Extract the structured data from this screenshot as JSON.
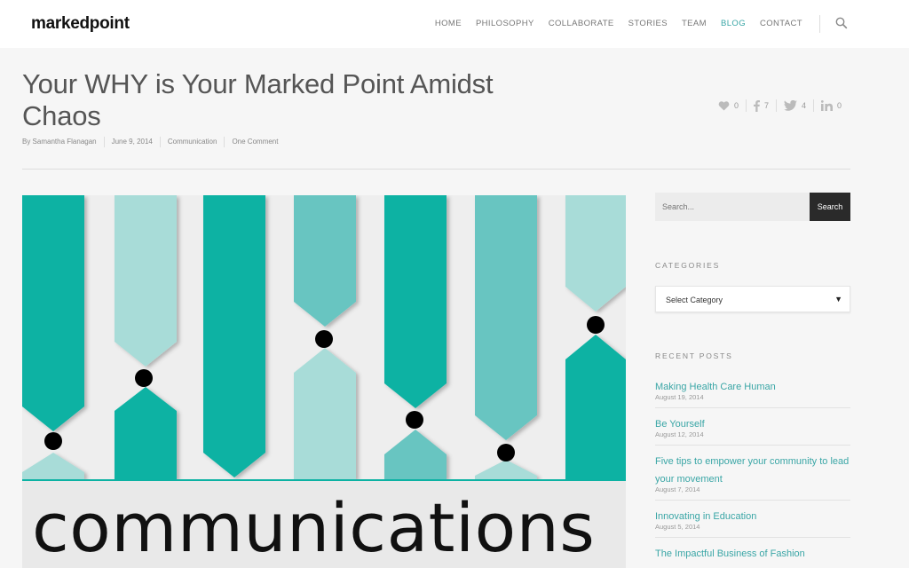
{
  "header": {
    "logo": "markedpoint",
    "nav": [
      {
        "label": "HOME"
      },
      {
        "label": "PHILOSOPHY"
      },
      {
        "label": "COLLABORATE"
      },
      {
        "label": "STORIES"
      },
      {
        "label": "TEAM"
      },
      {
        "label": "BLOG"
      },
      {
        "label": "CONTACT"
      }
    ],
    "active_nav": "BLOG",
    "accent_color": "#3aa6a6"
  },
  "post": {
    "title": "Your WHY is Your Marked Point Amidst Chaos",
    "author": "By Samantha Flanagan",
    "date": "June 9, 2014",
    "category": "Communication",
    "comments": "One Comment",
    "shares": {
      "likes": "0",
      "facebook": "7",
      "twitter": "4",
      "linkedin": "0"
    },
    "featured_word": "communications"
  },
  "sidebar": {
    "search_placeholder": "Search...",
    "search_button": "Search",
    "categories_title": "CATEGORIES",
    "category_select": "Select Category",
    "recent_title": "RECENT POSTS",
    "recent_posts": [
      {
        "title": "Making Health Care Human",
        "date": "August 19, 2014"
      },
      {
        "title": "Be Yourself",
        "date": "August 12, 2014"
      },
      {
        "title": "Five tips to empower your community to lead your movement",
        "date": "August 7, 2014"
      },
      {
        "title": "Innovating in Education",
        "date": "August 5, 2014"
      },
      {
        "title": "The Impactful Business of Fashion",
        "date": ""
      }
    ]
  }
}
